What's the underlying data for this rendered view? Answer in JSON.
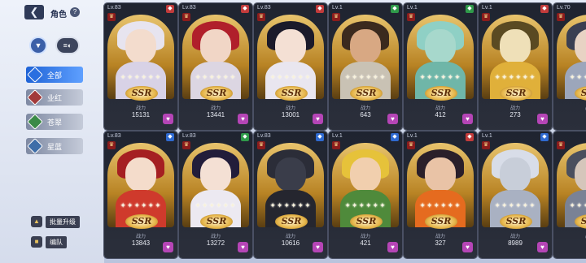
{
  "header": {
    "title": "角色",
    "help_label": "?",
    "back_icon": "arrow-back-icon"
  },
  "filters": {
    "filter_icon": "funnel-icon",
    "sort_icon": "sort-toggle-icon"
  },
  "categories": [
    {
      "label": "全部",
      "color": "#2a6fe0",
      "active": true
    },
    {
      "label": "业红",
      "color": "#a23a3a",
      "active": false
    },
    {
      "label": "苍翠",
      "color": "#3b8a47",
      "active": false
    },
    {
      "label": "星蓝",
      "color": "#3f6ea8",
      "active": false
    }
  ],
  "bottom_buttons": [
    {
      "label": "批量升级",
      "icon": "upgrade-icon"
    },
    {
      "label": "编队",
      "icon": "team-icon"
    }
  ],
  "power_label": "战力",
  "rarity_label": "SSR",
  "cards": [
    {
      "level": "Lv.83",
      "power": "15131",
      "element_color": "#c23b3b",
      "hair": "#e7e4ef",
      "skin": "#f3dccd",
      "outfit": "#d8d2e6"
    },
    {
      "level": "Lv.83",
      "power": "13441",
      "element_color": "#c23b3b",
      "hair": "#b01f2b",
      "skin": "#f1d6c6",
      "outfit": "#dcd6e2"
    },
    {
      "level": "Lv.83",
      "power": "13001",
      "element_color": "#c23b3b",
      "hair": "#1b1a2a",
      "skin": "#f4e0d4",
      "outfit": "#e9e6ef"
    },
    {
      "level": "Lv.1",
      "power": "643",
      "element_color": "#2f9a4a",
      "hair": "#3b2a1e",
      "skin": "#d8a883",
      "outfit": "#c9c2b4"
    },
    {
      "level": "Lv.1",
      "power": "412",
      "element_color": "#2f9a4a",
      "hair": "#8fd0c5",
      "skin": "#a7d8cc",
      "outfit": "#6fb6a8"
    },
    {
      "level": "Lv.1",
      "power": "273",
      "element_color": "#c23b3b",
      "hair": "#5a4a22",
      "skin": "#efe0b8",
      "outfit": "#e0b03a"
    },
    {
      "level": "Lv.70",
      "power": "",
      "element_color": "#c23b3b",
      "hair": "#3a3f52",
      "skin": "#e8d3c4",
      "outfit": "#9ca6bb"
    },
    {
      "level": "Lv.83",
      "power": "13843",
      "element_color": "#2f6ad0",
      "hair": "#a51f22",
      "skin": "#f4dccb",
      "outfit": "#cf3a2c"
    },
    {
      "level": "Lv.83",
      "power": "13272",
      "element_color": "#2f9a4a",
      "hair": "#221d3a",
      "skin": "#f4e0d4",
      "outfit": "#ece9f1"
    },
    {
      "level": "Lv.83",
      "power": "10616",
      "element_color": "#2f6ad0",
      "hair": "#2b2d38",
      "skin": "#3a3d4a",
      "outfit": "#25262f"
    },
    {
      "level": "Lv.1",
      "power": "421",
      "element_color": "#2f6ad0",
      "hair": "#e6c23a",
      "skin": "#f1cfae",
      "outfit": "#4f8a3b"
    },
    {
      "level": "Lv.1",
      "power": "327",
      "element_color": "#c23b3b",
      "hair": "#2a1f2a",
      "skin": "#e9c3a6",
      "outfit": "#e56b1f"
    },
    {
      "level": "Lv.1",
      "power": "8989",
      "element_color": "#2f6ad0",
      "hair": "#d8dde8",
      "skin": "#c8ced9",
      "outfit": "#a9b1c2"
    },
    {
      "level": "",
      "power": "",
      "element_color": "#2f6ad0",
      "hair": "#4a4f5e",
      "skin": "#d5c6bb",
      "outfit": "#7a8295"
    }
  ]
}
